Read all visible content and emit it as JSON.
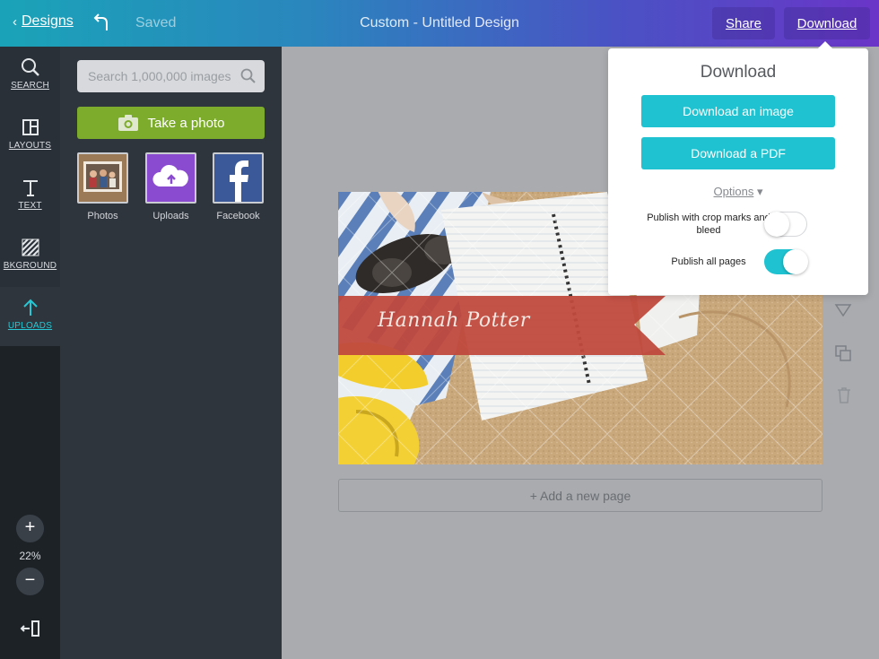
{
  "topbar": {
    "back_label": "Designs",
    "saved_label": "Saved",
    "title": "Custom - Untitled Design",
    "share_label": "Share",
    "download_label": "Download"
  },
  "rail": {
    "items": [
      {
        "label": "SEARCH",
        "icon": "search-icon"
      },
      {
        "label": "LAYOUTS",
        "icon": "layouts-icon"
      },
      {
        "label": "TEXT",
        "icon": "text-icon"
      },
      {
        "label": "BKGROUND",
        "icon": "background-icon"
      },
      {
        "label": "UPLOADS",
        "icon": "upload-arrow-icon"
      }
    ],
    "zoom": "22%"
  },
  "panel": {
    "search_placeholder": "Search 1,000,000 images",
    "take_photo_label": "Take a photo",
    "sources": [
      {
        "label": "Photos"
      },
      {
        "label": "Uploads"
      },
      {
        "label": "Facebook"
      }
    ]
  },
  "canvas": {
    "banner_text": "Hannah Potter",
    "banner_color": "#c0493d"
  },
  "add_page_label": "+ Add a new page",
  "download_popover": {
    "title": "Download",
    "image_button": "Download an image",
    "pdf_button": "Download a PDF",
    "options_label": "Options",
    "options": [
      {
        "label": "Publish with crop marks and bleed",
        "enabled": false
      },
      {
        "label": "Publish all pages",
        "enabled": true
      }
    ]
  },
  "colors": {
    "accent": "#1ec2d0",
    "photo_button": "#7dac2c",
    "rail_bg": "#1d2227",
    "panel_bg": "#2f353d"
  }
}
